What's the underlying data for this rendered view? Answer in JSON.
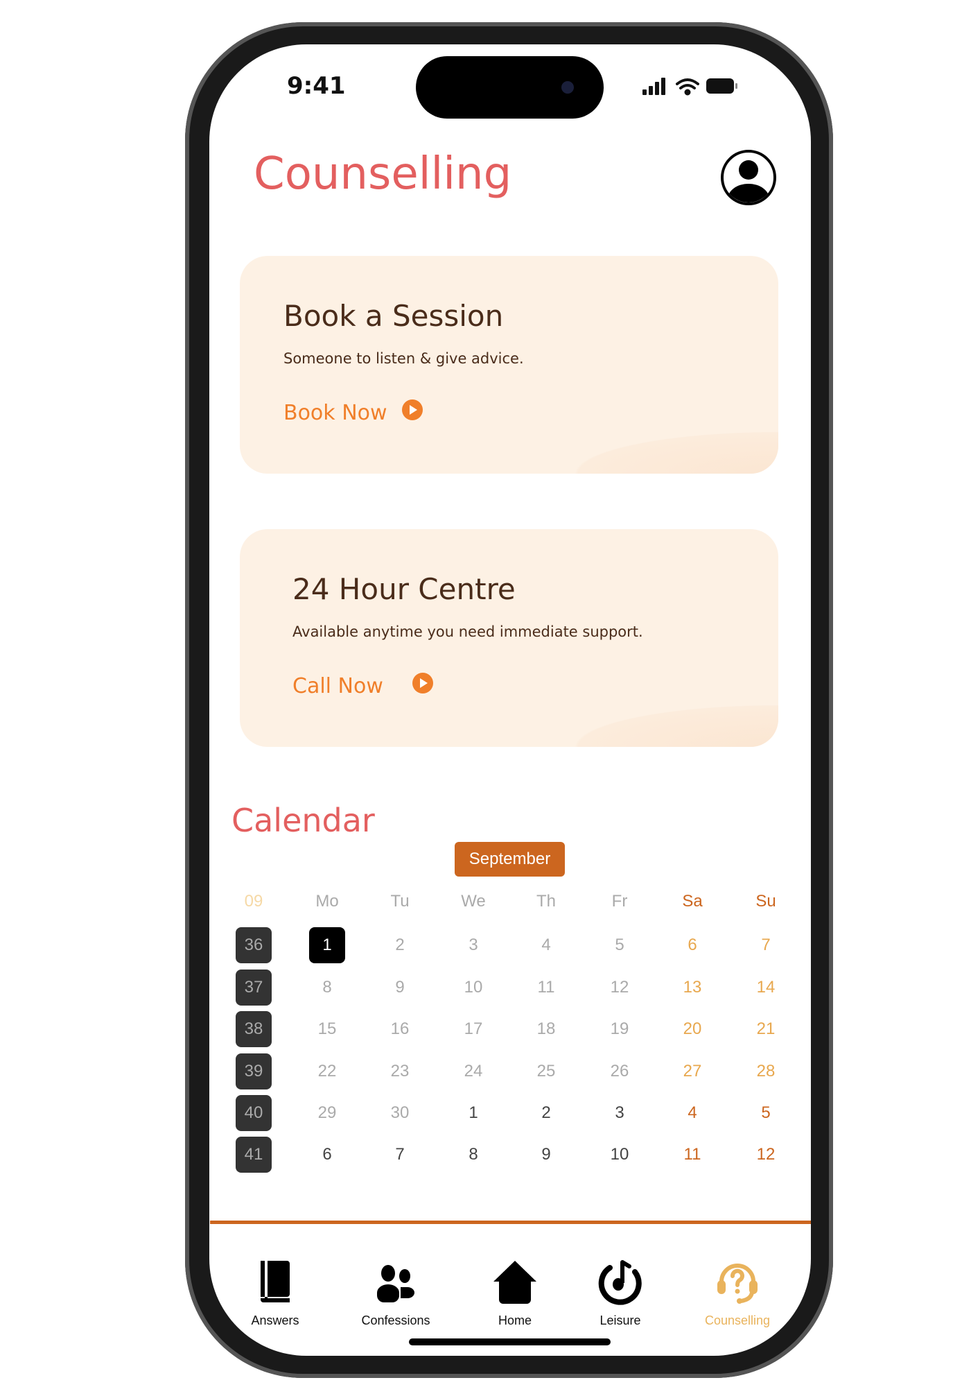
{
  "status": {
    "time": "9:41"
  },
  "header": {
    "title": "Counselling",
    "avatar_icon": "user-circle-icon"
  },
  "cards": [
    {
      "title": "Book a Session",
      "subtitle": "Someone to listen & give advice.",
      "link": "Book Now"
    },
    {
      "title": "24 Hour Centre",
      "subtitle": "Available anytime you need immediate support.",
      "link": "Call Now"
    }
  ],
  "calendar": {
    "title": "Calendar",
    "month": "September",
    "week_label": "09",
    "weekdays": [
      "Mo",
      "Tu",
      "We",
      "Th",
      "Fr",
      "Sa",
      "Su"
    ],
    "selected_day": "1",
    "weeks": [
      {
        "week": "36",
        "days": [
          "1",
          "2",
          "3",
          "4",
          "5",
          "6",
          "7"
        ]
      },
      {
        "week": "37",
        "days": [
          "8",
          "9",
          "10",
          "11",
          "12",
          "13",
          "14"
        ]
      },
      {
        "week": "38",
        "days": [
          "15",
          "16",
          "17",
          "18",
          "19",
          "20",
          "21"
        ]
      },
      {
        "week": "39",
        "days": [
          "22",
          "23",
          "24",
          "25",
          "26",
          "27",
          "28"
        ]
      },
      {
        "week": "40",
        "days": [
          "29",
          "30",
          "1",
          "2",
          "3",
          "4",
          "5"
        ]
      },
      {
        "week": "41",
        "days": [
          "6",
          "7",
          "8",
          "9",
          "10",
          "11",
          "12"
        ]
      }
    ]
  },
  "nav": [
    {
      "label": "Answers",
      "icon": "book-icon"
    },
    {
      "label": "Confessions",
      "icon": "users-icon"
    },
    {
      "label": "Home",
      "icon": "home-icon"
    },
    {
      "label": "Leisure",
      "icon": "music-icon"
    },
    {
      "label": "Counselling",
      "icon": "headset-question-icon",
      "active": true
    }
  ],
  "colors": {
    "accent": "#cc661f",
    "title": "#e35f5f",
    "card_bg": "#fdf1e4",
    "link": "#f07f2a",
    "nav_active": "#e9b35c"
  }
}
